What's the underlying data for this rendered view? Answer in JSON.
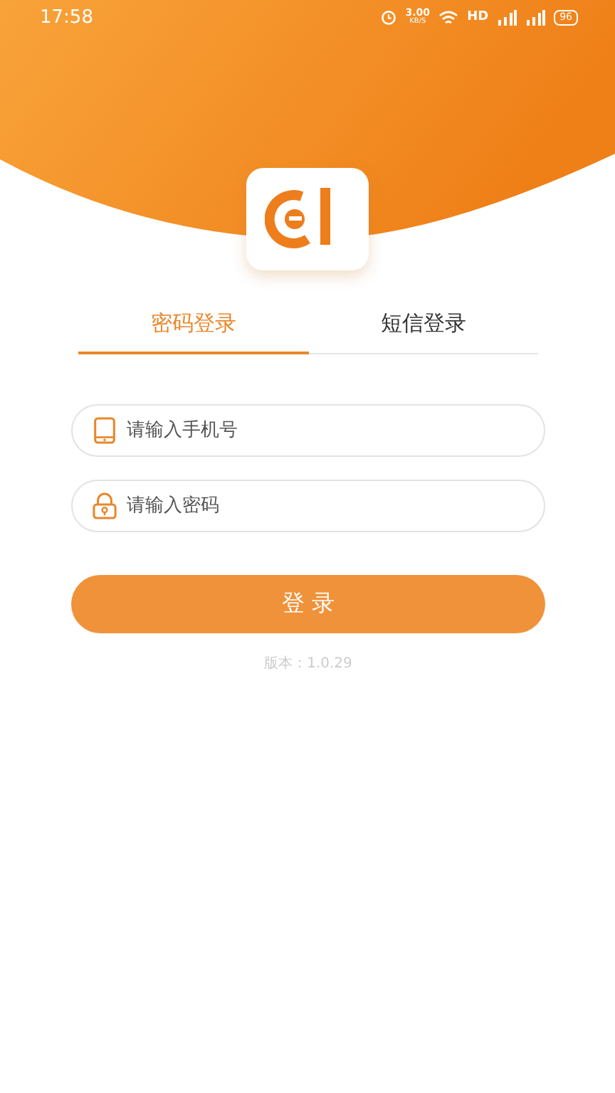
{
  "status_bar": {
    "time": "17:58",
    "net_speed": "3.00",
    "net_unit": "KB/S",
    "hd": "HD",
    "battery": "96"
  },
  "tabs": [
    {
      "label": "密码登录",
      "selected": true
    },
    {
      "label": "短信登录",
      "selected": false
    }
  ],
  "fields": [
    {
      "kind": "phone",
      "placeholder": "请输入手机号"
    },
    {
      "kind": "password",
      "placeholder": "请输入密码"
    }
  ],
  "login_button": "登 录",
  "version": "版本：1.0.29"
}
